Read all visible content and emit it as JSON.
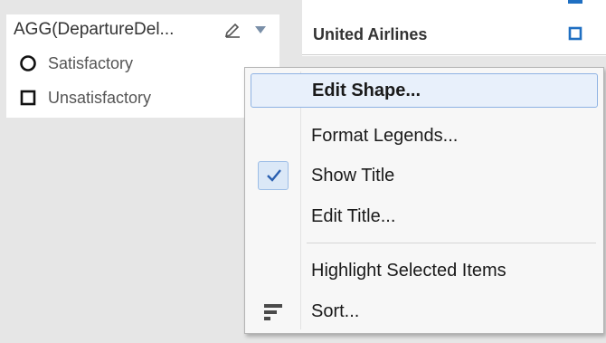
{
  "legend": {
    "title": "AGG(DepartureDel...",
    "items": [
      {
        "shape": "circle-outline-icon",
        "label": "Satisfactory"
      },
      {
        "shape": "square-outline-icon",
        "label": "Unsatisfactory"
      }
    ]
  },
  "right_panel": {
    "airline": "United Airlines",
    "mark_color": "#1f6fc2"
  },
  "menu": {
    "items": [
      {
        "label": "Edit Shape...",
        "state": "highlighted"
      },
      {
        "label": "Format Legends..."
      },
      {
        "label": "Show Title",
        "checked": true
      },
      {
        "label": "Edit Title..."
      },
      {
        "label": "Highlight Selected Items"
      },
      {
        "label": "Sort...",
        "icon": "sort-icon"
      }
    ]
  },
  "colors": {
    "accent_blue": "#1f6fc2",
    "highlight_bg": "#e8f0fb",
    "highlight_border": "#8fb3e3"
  }
}
